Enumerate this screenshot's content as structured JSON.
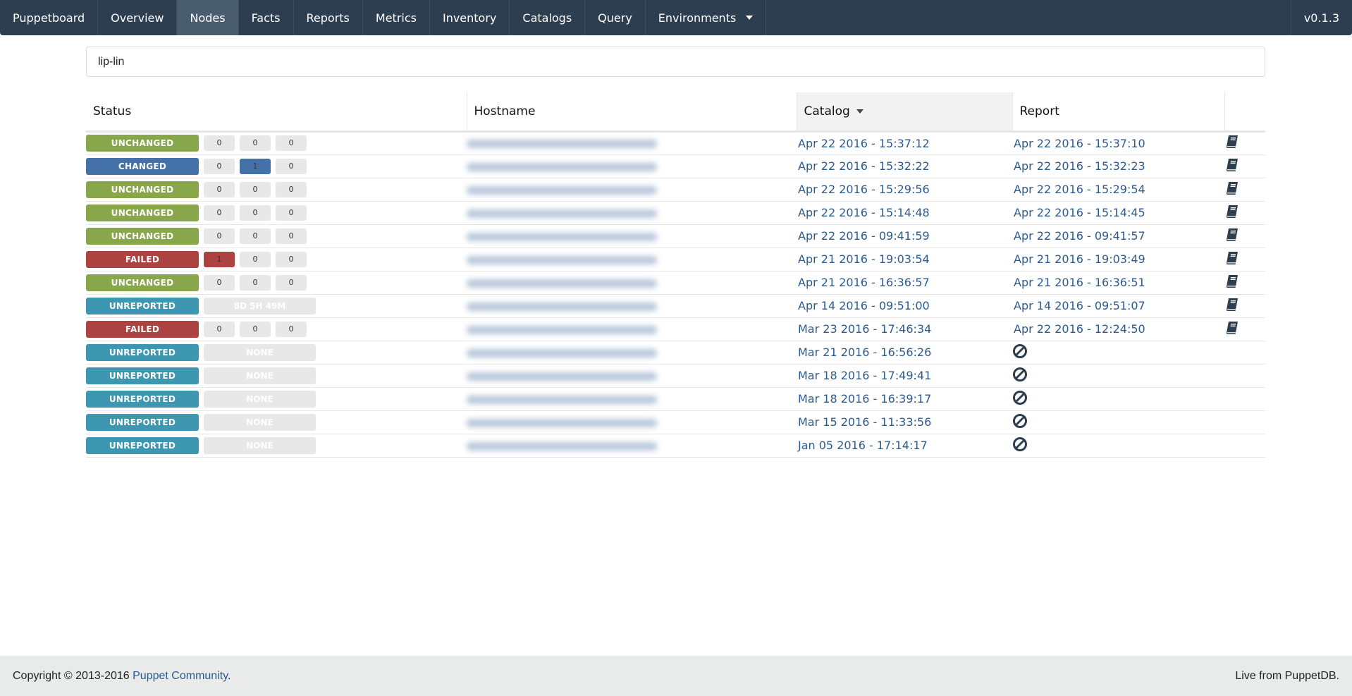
{
  "nav": {
    "brand": "Puppetboard",
    "items": [
      "Overview",
      "Nodes",
      "Facts",
      "Reports",
      "Metrics",
      "Inventory",
      "Catalogs",
      "Query",
      "Environments"
    ],
    "active": "Nodes",
    "version": "v0.1.3"
  },
  "search": {
    "value": "lip-lin"
  },
  "table": {
    "headers": {
      "status": "Status",
      "hostname": "Hostname",
      "catalog": "Catalog",
      "report": "Report"
    },
    "sort": {
      "column": "Catalog",
      "direction": "descending"
    },
    "rows": [
      {
        "status": "UNCHANGED",
        "counts": [
          "0",
          "0",
          "0"
        ],
        "catalog": "Apr 22 2016 - 15:37:12",
        "report": "Apr 22 2016 - 15:37:10",
        "icon": "book-icon"
      },
      {
        "status": "CHANGED",
        "counts": [
          "0",
          "1",
          "0"
        ],
        "catalog": "Apr 22 2016 - 15:32:22",
        "report": "Apr 22 2016 - 15:32:23",
        "icon": "book-icon"
      },
      {
        "status": "UNCHANGED",
        "counts": [
          "0",
          "0",
          "0"
        ],
        "catalog": "Apr 22 2016 - 15:29:56",
        "report": "Apr 22 2016 - 15:29:54",
        "icon": "book-icon"
      },
      {
        "status": "UNCHANGED",
        "counts": [
          "0",
          "0",
          "0"
        ],
        "catalog": "Apr 22 2016 - 15:14:48",
        "report": "Apr 22 2016 - 15:14:45",
        "icon": "book-icon"
      },
      {
        "status": "UNCHANGED",
        "counts": [
          "0",
          "0",
          "0"
        ],
        "catalog": "Apr 22 2016 - 09:41:59",
        "report": "Apr 22 2016 - 09:41:57",
        "icon": "book-icon"
      },
      {
        "status": "FAILED",
        "counts": [
          "1",
          "0",
          "0"
        ],
        "catalog": "Apr 21 2016 - 19:03:54",
        "report": "Apr 21 2016 - 19:03:49",
        "icon": "book-icon"
      },
      {
        "status": "UNCHANGED",
        "counts": [
          "0",
          "0",
          "0"
        ],
        "catalog": "Apr 21 2016 - 16:36:57",
        "report": "Apr 21 2016 - 16:36:51",
        "icon": "book-icon"
      },
      {
        "status": "UNREPORTED",
        "since": "8D 5H 49M",
        "catalog": "Apr 14 2016 - 09:51:00",
        "report": "Apr 14 2016 - 09:51:07",
        "icon": "book-icon"
      },
      {
        "status": "FAILED",
        "counts": [
          "0",
          "0",
          "0"
        ],
        "catalog": "Mar 23 2016 - 17:46:34",
        "report": "Apr 22 2016 - 12:24:50",
        "icon": "book-icon"
      },
      {
        "status": "UNREPORTED",
        "since": "NONE",
        "catalog": "Mar 21 2016 - 16:56:26",
        "report_icon": "ban-icon"
      },
      {
        "status": "UNREPORTED",
        "since": "NONE",
        "catalog": "Mar 18 2016 - 17:49:41",
        "report_icon": "ban-icon"
      },
      {
        "status": "UNREPORTED",
        "since": "NONE",
        "catalog": "Mar 18 2016 - 16:39:17",
        "report_icon": "ban-icon"
      },
      {
        "status": "UNREPORTED",
        "since": "NONE",
        "catalog": "Mar 15 2016 - 11:33:56",
        "report_icon": "ban-icon"
      },
      {
        "status": "UNREPORTED",
        "since": "NONE",
        "catalog": "Jan 05 2016 - 17:14:17",
        "report_icon": "ban-icon"
      }
    ]
  },
  "colors": {
    "UNCHANGED": "#88a74a",
    "CHANGED": "#4472a8",
    "FAILED": "#ad4341",
    "UNREPORTED": "#3d97b0",
    "navbar": "#2c3e50",
    "link": "#2c5a8c"
  },
  "footer": {
    "copyright": "Copyright © 2013-2016 ",
    "link": "Puppet Community",
    "period": ".",
    "right": "Live from PuppetDB."
  }
}
